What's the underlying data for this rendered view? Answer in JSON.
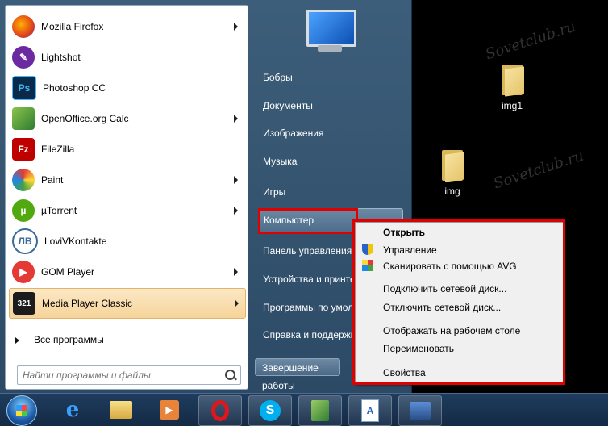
{
  "start_menu": {
    "programs": [
      {
        "label": "Mozilla Firefox",
        "icon": "firefox-icon",
        "has_submenu": true
      },
      {
        "label": "Lightshot",
        "icon": "lightshot-icon",
        "has_submenu": false
      },
      {
        "label": "Photoshop CC",
        "icon": "photoshop-icon",
        "has_submenu": false
      },
      {
        "label": "OpenOffice.org Calc",
        "icon": "openoffice-calc-icon",
        "has_submenu": true
      },
      {
        "label": "FileZilla",
        "icon": "filezilla-icon",
        "has_submenu": false
      },
      {
        "label": "Paint",
        "icon": "paint-icon",
        "has_submenu": true
      },
      {
        "label": "µTorrent",
        "icon": "utorrent-icon",
        "has_submenu": true
      },
      {
        "label": "LoviVKontakte",
        "icon": "lovivkontakte-icon",
        "has_submenu": false
      },
      {
        "label": "GOM Player",
        "icon": "gom-player-icon",
        "has_submenu": true
      },
      {
        "label": "Media Player Classic",
        "icon": "media-player-classic-icon",
        "has_submenu": true
      }
    ],
    "all_programs": "Все программы",
    "search_placeholder": "Найти программы и файлы",
    "right_items": {
      "user": "Бобры",
      "documents": "Документы",
      "pictures": "Изображения",
      "music": "Музыка",
      "games": "Игры",
      "computer": "Компьютер",
      "control_panel": "Панель управления",
      "devices": "Устройства и принте",
      "default_programs": "Программы по умол",
      "help": "Справка и поддержк"
    },
    "shutdown": "Завершение работы"
  },
  "context_menu": {
    "open": "Открыть",
    "manage": "Управление",
    "scan": "Сканировать с помощью AVG",
    "map_drive": "Подключить сетевой диск...",
    "disconnect_drive": "Отключить сетевой диск...",
    "show_on_desktop": "Отображать на рабочем столе",
    "rename": "Переименовать",
    "properties": "Свойства"
  },
  "desktop": {
    "icons": [
      {
        "label": "img1"
      },
      {
        "label": "img"
      }
    ],
    "watermark": "Sovetclub.ru"
  },
  "taskbar": {
    "items": [
      "ie-icon",
      "explorer-icon",
      "media-player-icon",
      "opera-icon",
      "skype-icon",
      "calc-icon",
      "document-icon",
      "network-icon"
    ]
  },
  "colors": {
    "highlight_border": "#e10000",
    "menu_bg": "#2c4a66"
  }
}
